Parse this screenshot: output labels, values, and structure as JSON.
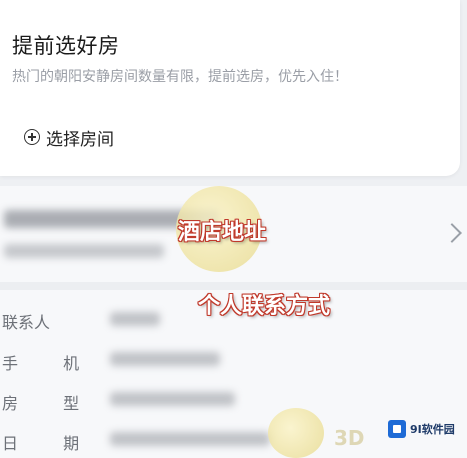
{
  "card": {
    "title": "提前选好房",
    "subtitle": "热门的朝阳安静房间数量有限，提前选房，优先入住！",
    "pick_room_label": "选择房间"
  },
  "overlay": {
    "hotel_address": "酒店地址",
    "contact_info": "个人联系方式"
  },
  "info": {
    "contact_label": "联系人",
    "phone_label": "手 机",
    "room_type_label": "房 型",
    "date_label": "日 期"
  },
  "watermark": {
    "text": "3D",
    "badge": "9I软件园"
  },
  "icons": {
    "plus": "plus-circle-icon",
    "chevron": "chevron-right-icon"
  },
  "colors": {
    "background": "#eef0f3",
    "overlay_stroke": "#c0392b"
  }
}
